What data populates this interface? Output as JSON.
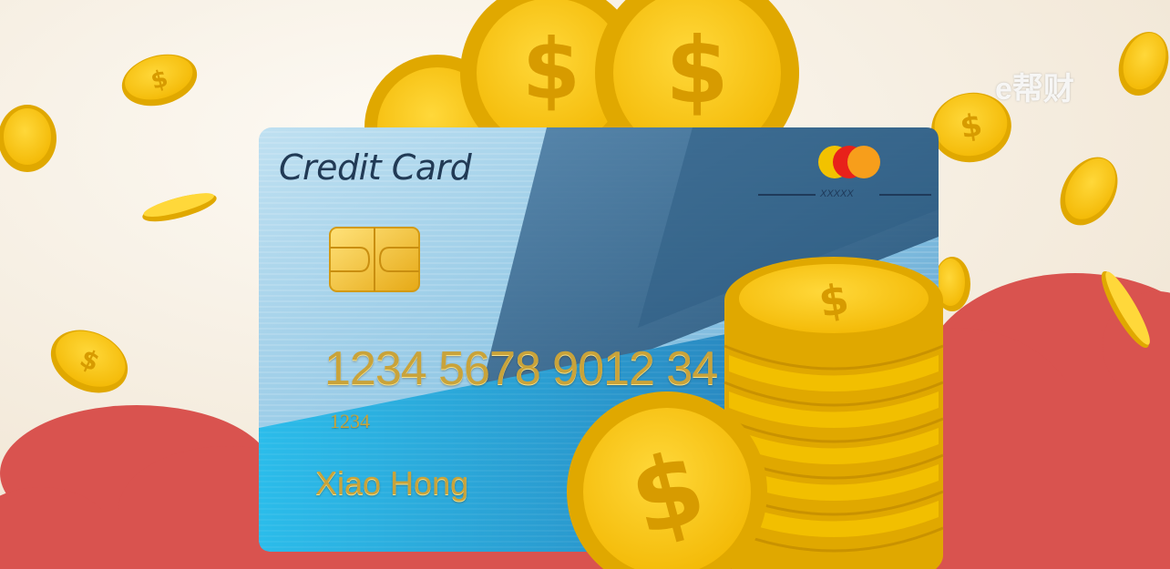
{
  "card": {
    "title": "Credit Card",
    "number": "1234 5678 9012 34",
    "sub_number": "1234",
    "holder": "Xiao Hong",
    "brand_code": "XXXXX"
  },
  "watermark": "e帮财",
  "colors": {
    "background": "#f6efe4",
    "cloud": "#d9534f",
    "card_light": "#a9d3ea",
    "card_dark": "#2f5f85",
    "coin_gold": "#f7c500",
    "coin_dark": "#e0a800",
    "brand_red": "#e8211a",
    "brand_orange": "#f79e1b"
  }
}
